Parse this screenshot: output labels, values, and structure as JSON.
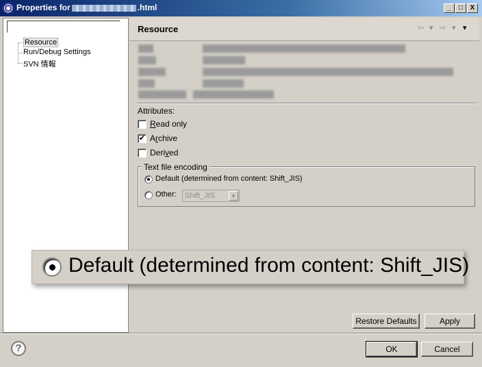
{
  "window": {
    "title_prefix": "Properties for",
    "title_suffix": ".html",
    "minimize_glyph": "_",
    "maximize_glyph": "□",
    "close_glyph": "X"
  },
  "tree": {
    "items": [
      {
        "label": "Resource"
      },
      {
        "label": "Run/Debug Settings"
      },
      {
        "label": "SVN 情報"
      }
    ]
  },
  "page": {
    "title": "Resource",
    "nav": {
      "back": "⇦",
      "forward": "⇨",
      "menu": "▾"
    }
  },
  "attributes": {
    "label": "Attributes:",
    "read_only": {
      "label": "Read only",
      "checked": false
    },
    "archive": {
      "label": "Archive",
      "checked": true
    },
    "derived": {
      "label": "Derived",
      "checked": false
    }
  },
  "encoding": {
    "legend": "Text file encoding",
    "default_option": {
      "label": "Default (determined from content: Shift_JIS)",
      "selected": true
    },
    "other_option": {
      "label": "Other:",
      "selected": false
    },
    "other_value": "Shift_JIS"
  },
  "buttons": {
    "restore_defaults": "Restore Defaults",
    "apply": "Apply",
    "ok": "OK",
    "cancel": "Cancel"
  },
  "callout": {
    "text": "Default (determined from content: Shift_JIS)"
  }
}
